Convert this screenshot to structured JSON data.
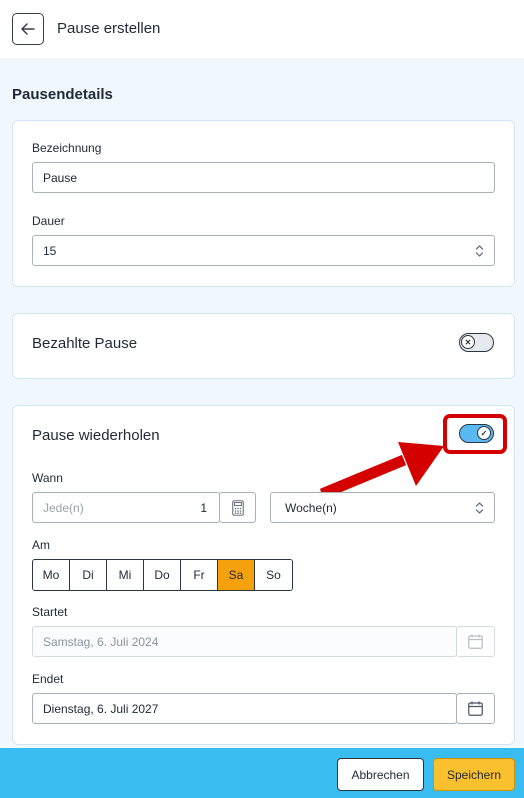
{
  "header": {
    "title": "Pause erstellen"
  },
  "details": {
    "section_title": "Pausendetails",
    "name_label": "Bezeichnung",
    "name_value": "Pause",
    "duration_label": "Dauer",
    "duration_value": "15"
  },
  "paid": {
    "title": "Bezahlte Pause",
    "enabled": false
  },
  "repeat": {
    "title": "Pause wiederholen",
    "enabled": true,
    "when_label": "Wann",
    "every_placeholder": "Jede(n)",
    "every_value": "1",
    "unit_value": "Woche(n)",
    "on_label": "Am",
    "days": [
      "Mo",
      "Di",
      "Mi",
      "Do",
      "Fr",
      "Sa",
      "So"
    ],
    "selected_day": "Sa",
    "start_label": "Startet",
    "start_value": "Samstag, 6. Juli 2024",
    "end_label": "Endet",
    "end_value": "Dienstag, 6. Juli 2027"
  },
  "footer": {
    "cancel_label": "Abbrechen",
    "save_label": "Speichern"
  },
  "colors": {
    "accent_blue": "#39bdf0",
    "toggle_on": "#5ab8f3",
    "selected_day": "#f5a00d",
    "save_button": "#fbc02d",
    "annotation_red": "#d40000"
  },
  "icons": {
    "back": "arrow-left-icon",
    "calculator": "calculator-icon",
    "calendar": "calendar-icon",
    "stepper": "chevron-up-down-icon",
    "toggle_off": "x-icon",
    "toggle_on": "check-icon"
  }
}
